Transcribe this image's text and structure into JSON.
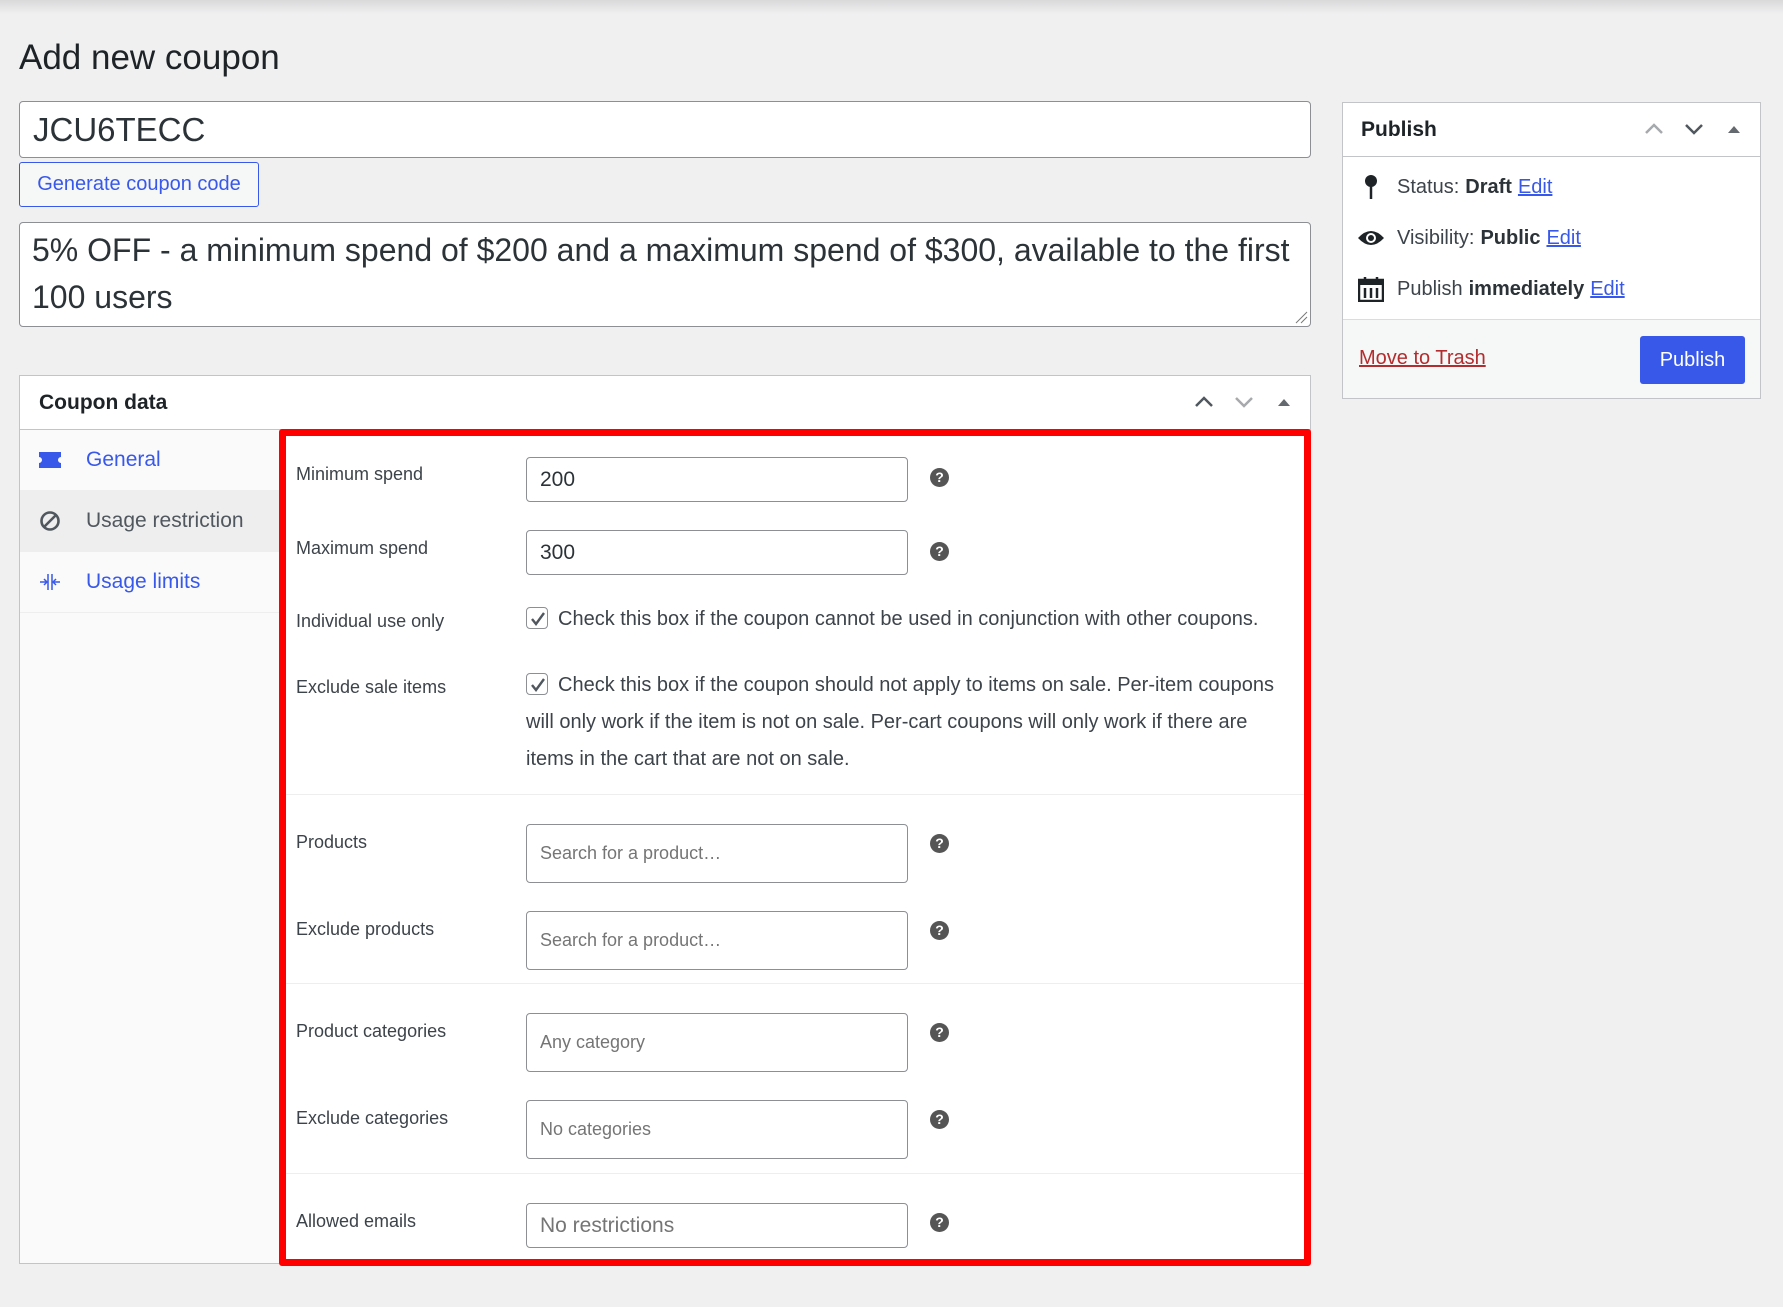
{
  "page": {
    "title": "Add new coupon"
  },
  "coupon": {
    "code": "JCU6TECC",
    "generate_label": "Generate coupon code",
    "description": "5% OFF - a minimum spend of $200 and a maximum spend of $300, available to the first 100 users"
  },
  "coupon_data": {
    "title": "Coupon data",
    "controls": [
      "move-up",
      "move-down",
      "toggle-panel"
    ],
    "tabs": [
      {
        "label": "General",
        "icon": "ticket-icon",
        "active": false
      },
      {
        "label": "Usage restriction",
        "icon": "block-icon",
        "active": true
      },
      {
        "label": "Usage limits",
        "icon": "limits-icon",
        "active": false
      }
    ],
    "highlight_color": "#ff0000",
    "fields": {
      "minimum_spend": {
        "label": "Minimum spend",
        "value": "200"
      },
      "maximum_spend": {
        "label": "Maximum spend",
        "value": "300"
      },
      "individual_use": {
        "label": "Individual use only",
        "checked": true,
        "description": "Check this box if the coupon cannot be used in conjunction with other coupons."
      },
      "exclude_sale": {
        "label": "Exclude sale items",
        "checked": true,
        "description": "Check this box if the coupon should not apply to items on sale. Per-item coupons will only work if the item is not on sale. Per-cart coupons will only work if there are items in the cart that are not on sale."
      },
      "products": {
        "label": "Products",
        "placeholder": "Search for a product…"
      },
      "exclude_products": {
        "label": "Exclude products",
        "placeholder": "Search for a product…"
      },
      "product_categories": {
        "label": "Product categories",
        "placeholder": "Any category"
      },
      "exclude_categories": {
        "label": "Exclude categories",
        "placeholder": "No categories"
      },
      "allowed_emails": {
        "label": "Allowed emails",
        "placeholder": "No restrictions"
      }
    },
    "help_glyph": "?"
  },
  "publish": {
    "title": "Publish",
    "status_label": "Status:",
    "status_value": "Draft",
    "visibility_label": "Visibility:",
    "visibility_value": "Public",
    "schedule_label": "Publish",
    "schedule_value": "immediately",
    "edit_label": "Edit",
    "trash_label": "Move to Trash",
    "publish_button": "Publish"
  },
  "colors": {
    "accent": "#3858e9",
    "danger": "#b32d2e",
    "background": "#f0f0f1"
  }
}
